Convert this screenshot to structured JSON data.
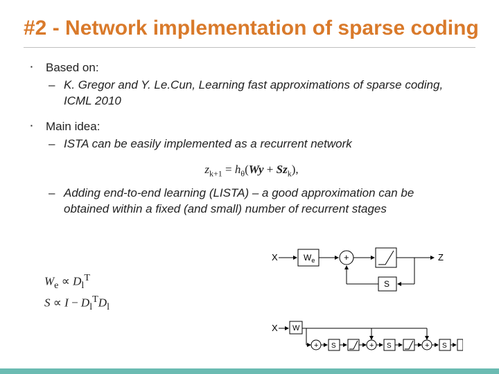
{
  "title": "#2 - Network implementation of sparse coding",
  "bullets": {
    "basedOn": {
      "label": "Based on:",
      "ref": "K. Gregor and Y. Le.Cun, Learning fast approximations of sparse coding, ICML 2010"
    },
    "mainIdea": {
      "label": "Main idea:",
      "p1": "ISTA can be easily implemented as a recurrent network",
      "p2": "Adding end-to-end learning (LISTA) – a good approximation can be obtained within a fixed (and small) number of recurrent stages"
    }
  },
  "equation": {
    "lhs": "z",
    "lhsSub": "k+1",
    "eq": " = ",
    "fn": "h",
    "fnSub": "θ",
    "argOpen": "(",
    "t1": "W",
    "t2": "y",
    "plus": " + ",
    "t3": "S",
    "t4": "z",
    "t4Sub": "k",
    "argClose": "),"
  },
  "sideEq": {
    "line1": {
      "a": "W",
      "aSub": "e",
      "rel": " ∝ ",
      "b": "D",
      "bSup": "T",
      "bSub": "l"
    },
    "line2": {
      "a": "S",
      "rel": " ∝ ",
      "b": "I",
      "minus": " − ",
      "c": "D",
      "cSup": "T",
      "cSub": "l",
      "d": "D",
      "dSub": "l"
    }
  },
  "diagram": {
    "x": "X",
    "We": "W",
    "WeSub": "e",
    "plus": "+",
    "thresh": "",
    "z": "Z",
    "S": "S",
    "W": "W"
  }
}
